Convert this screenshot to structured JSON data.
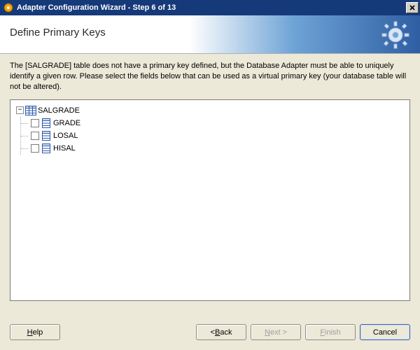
{
  "window": {
    "title": "Adapter Configuration Wizard - Step 6 of 13"
  },
  "banner": {
    "page_title": "Define Primary Keys"
  },
  "description": "The [SALGRADE] table does not have a primary key defined, but the Database Adapter must be able to uniquely identify a given row.  Please select the fields below that can be used as a virtual primary key (your database table will not be altered).",
  "tree": {
    "toggle_symbol": "−",
    "table_name": "SALGRADE",
    "columns": [
      {
        "name": "GRADE"
      },
      {
        "name": "LOSAL"
      },
      {
        "name": "HISAL"
      }
    ]
  },
  "buttons": {
    "help": "Help",
    "back": "< Back",
    "next": "Next >",
    "finish": "Finish",
    "cancel": "Cancel"
  }
}
